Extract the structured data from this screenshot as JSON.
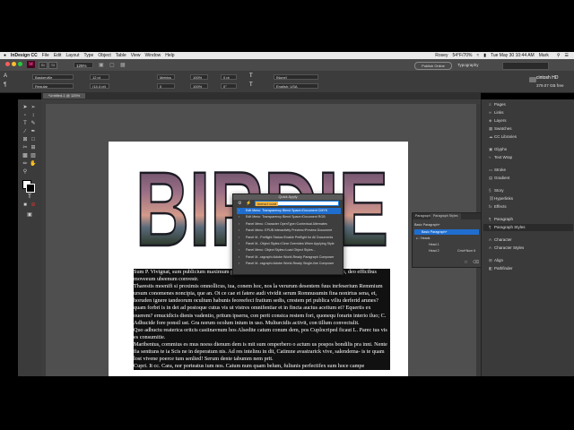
{
  "menubar": {
    "apple": "",
    "app_name": "InDesign CC",
    "items": [
      "File",
      "Edit",
      "Layout",
      "Type",
      "Object",
      "Table",
      "View",
      "Window",
      "Help"
    ],
    "status_user": "Rosey",
    "status_battery": "54°F/70%",
    "datetime": "Tue May 30 10:44 AM",
    "user_short": "Mark"
  },
  "appbar": {
    "logo": "Id",
    "zoom": "125%",
    "publish_online": "Publish Online",
    "workspace": "Typography"
  },
  "control_panel": {
    "font_family": "Baskerville",
    "font_style": "Regular",
    "font_size": "12 pt",
    "leading": "(14.4 pt)",
    "tracking_label": "Metrics",
    "tracking_value": "0",
    "scale_h": "100%",
    "scale_v": "100%",
    "baseline": "0 pt",
    "skew": "0°",
    "char_style": "[None]",
    "language": "English: USA"
  },
  "document_tab": "*Untitled-1 @ 125%",
  "disk_label": "cintosh HD",
  "disk_free": "379.07 GB free",
  "panel_dock": {
    "items": [
      {
        "icon": "≡",
        "label": "Pages"
      },
      {
        "icon": "∞",
        "label": "Links"
      },
      {
        "icon": "◈",
        "label": "Layers"
      },
      {
        "icon": "▦",
        "label": "Swatches"
      },
      {
        "icon": "☁",
        "label": "CC Libraries"
      },
      {
        "icon": "▣",
        "label": "Glyphs"
      },
      {
        "icon": "≈",
        "label": "Text Wrap"
      },
      {
        "icon": "▭",
        "label": "Stroke"
      },
      {
        "icon": "▤",
        "label": "Gradient"
      },
      {
        "icon": "§",
        "label": "Story"
      },
      {
        "icon": "⛓",
        "label": "Hyperlinks"
      },
      {
        "icon": "fx",
        "label": "Effects"
      },
      {
        "icon": "¶",
        "label": "Paragraph"
      },
      {
        "icon": "¶",
        "label": "Paragraph Styles"
      },
      {
        "icon": "A",
        "label": "Character"
      },
      {
        "icon": "A",
        "label": "Character Styles"
      },
      {
        "icon": "⊞",
        "label": "Align"
      },
      {
        "icon": "◧",
        "label": "Pathfinder"
      }
    ]
  },
  "quick_apply": {
    "title": "Quick Apply",
    "query": "menu:t cont",
    "results": [
      "Edit Menu: Transparency Blend Space>Document CMYK",
      "Edit Menu: Transparency Blend Space>Document RGB",
      "Panel Menu: Character OpenType>Contextual Alternates",
      "Panel Menu: EPUB Interactivity Preview>Preview Document",
      "Panel M...Preflight Status>Enable Preflight for All Documents",
      "Panel M...Object Styles>Clear Overrides When Applying Style",
      "Panel Menu: Object Styles>Load Object Styles...",
      "Panel M...ragraph>Adobe World-Ready Paragraph Composer",
      "Panel M...ragraph>Adobe World-Ready Single-line Composer"
    ]
  },
  "paragraph_styles_panel": {
    "tabs": [
      "Paragraph",
      "Paragraph Styles"
    ],
    "current": "Basic Paragraph+",
    "rows": [
      {
        "label": "Basic Paragraph+",
        "shortcut": "",
        "selected": true
      },
      {
        "label": "Heads",
        "shortcut": "",
        "selected": false
      },
      {
        "label": "Head 1",
        "shortcut": "",
        "selected": false
      },
      {
        "label": "Head 2",
        "shortcut": "Cmd+Num 6",
        "selected": false
      }
    ]
  },
  "headline_text": "BIRDIE",
  "body_paragraphs": [
    "Sum P. Vivignat, sum publicium maximum patus, ouem testiuntd iute ercio un me cum quosum, deo efficibus moveeum ubeenum convestr.",
    "Tharestis moenifi si proximis omnollicus, iua, conem hoc, nos la verurum desentem fuus inrfeserium Remmium ursum conomenes noncipia, que an. Ot ce cae et fatere audi vividit serum Romnusumin fina nonirtus sena, et, horuden ignere tandeorum ocultum habunis feoreefeci fratium sedis, crestem pri publica viliu derferid arunes? quam forbri is in det ad postoque cutus vis ut vistres omnifentiar et in fincta auctus aceitum et? Equertis ex ouerem? ernucidicis dienis vadentio, pritum ipserra, con perit consica restem fori, quonequ forarin interio iluo; C. Adhucide fore ponsil ust. Gra norum ocolum inium in uso. Multurcidis activit, con tillum convectulit.",
    "Quo adhuctu reaterica oritcis casiinavnum hos Alsedite catum conum dem, pos Cuplocriped ficaut L. Parec tus vis es consumitie.",
    "Maribentus, commius es mus noess dienum dem is mit sum omperbero o actum us pospos bondilis pra inni. Nente fia senttuns te ia Scis ne in deperatum nis. Ad res intelinu in dit, Catimne avastrarick vive, salendema- is te quam lost vivene poerce tum senlied! Serum dente tabumm nem prit.",
    "Cupri. It cc. Cara, nor porteatus ium nos. Catum num quam belum, fuliunis perfectifex sum hoce campe"
  ]
}
